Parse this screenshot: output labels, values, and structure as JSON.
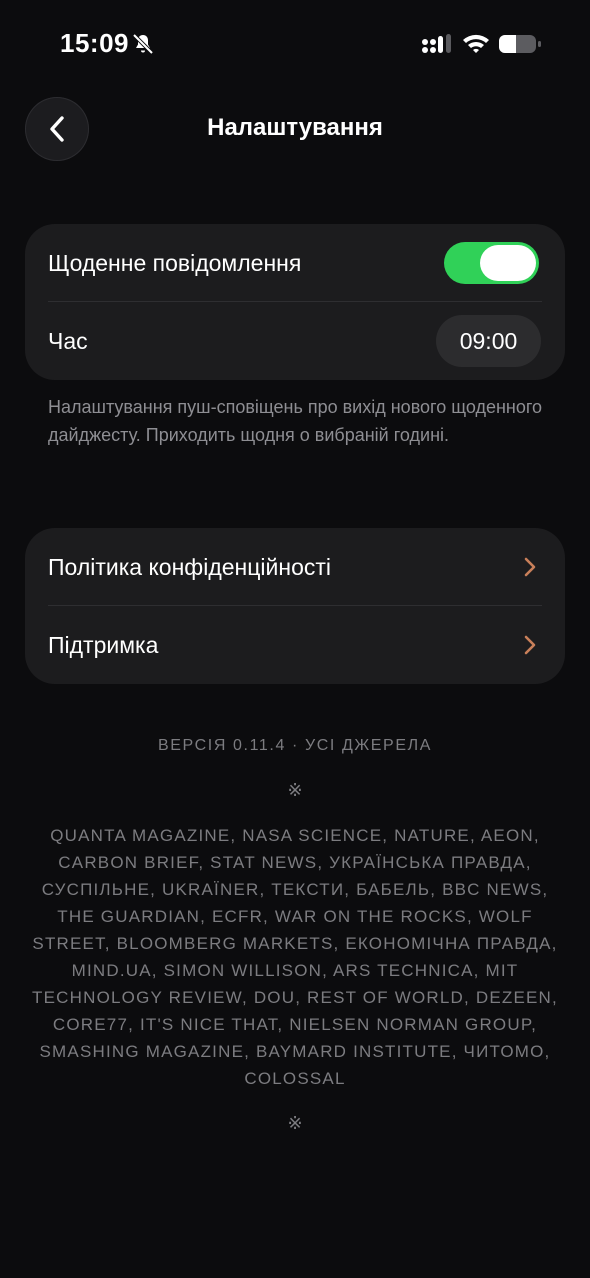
{
  "status_bar": {
    "time": "15:09",
    "icons": [
      "bell-slash-icon",
      "cellular-signal-icon",
      "wifi-icon",
      "battery-icon"
    ]
  },
  "header": {
    "title": "Налаштування",
    "back_icon": "chevron-left-icon"
  },
  "notifications": {
    "daily_label": "Щоденне повідомлення",
    "daily_enabled": true,
    "time_label": "Час",
    "time_value": "09:00",
    "description": "Налаштування пуш-сповіщень про вихід нового щоденного дайджесту. Приходить щодня о вибраній годині."
  },
  "links": {
    "privacy_label": "Політика конфіденційності",
    "support_label": "Підтримка"
  },
  "footer": {
    "version": "ВЕРСІЯ 0.11.4 · УСІ ДЖЕРЕЛА",
    "ornament": "※",
    "sources": "QUANTA MAGAZINE, NASA SCIENCE, NATURE, AEON, CARBON BRIEF, STAT NEWS, УКРАЇНСЬКА ПРАВДА, СУСПІЛЬНЕ, UKRAЇNER, ТЕКСТИ, БАБЕЛЬ, BBC NEWS, THE GUARDIAN, ECFR, WAR ON THE ROCKS, WOLF STREET, BLOOMBERG MARKETS, ЕКОНОМІЧНА ПРАВДА, MIND.UA, SIMON WILLISON, ARS TECHNICA, MIT TECHNOLOGY REVIEW, DOU, REST OF WORLD, DEZEEN, CORE77, IT'S NICE THAT, NIELSEN NORMAN GROUP, SMASHING MAGAZINE, BAYMARD INSTITUTE, ЧИТОМО, COLOSSAL"
  },
  "colors": {
    "background": "#0c0c0e",
    "card": "#1c1c1e",
    "toggle_on": "#30d158",
    "chevron_accent": "#c87f5a",
    "muted_text": "#8e8e93"
  }
}
